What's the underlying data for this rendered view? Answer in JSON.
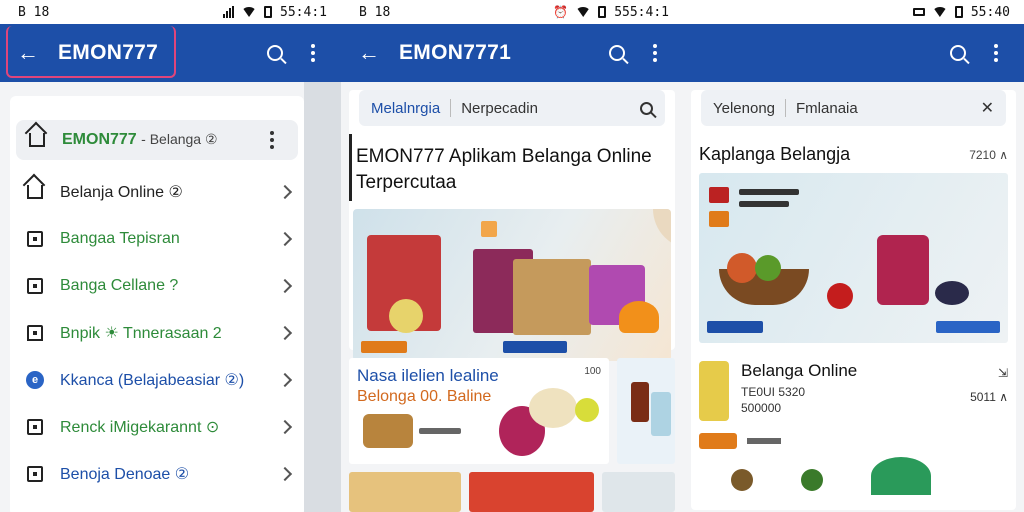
{
  "status_left": [
    "B 18",
    "B 18"
  ],
  "status_time": [
    "55:4:1",
    "555:4:1",
    "55:40"
  ],
  "app_title": [
    "EMON777",
    "EMON7771"
  ],
  "screen1": {
    "selected_item": {
      "title": "EMON777",
      "sub": "- Belanga ②"
    },
    "items": [
      {
        "label": "Belanja Online ②",
        "color": "#222222",
        "icon": "home-icon"
      },
      {
        "label": "Bangaa Tepisran",
        "color": "#2e8b3a",
        "icon": "box-icon"
      },
      {
        "label": "Banga Cellane ?",
        "color": "#2e8b3a",
        "icon": "square-icon"
      },
      {
        "label": "Bnpik ☀ Tnnerasaan 2",
        "color": "#2e8b3a",
        "icon": "bookmark-icon"
      },
      {
        "label": "Kkanca (Belajabeasiar ②)",
        "color": "#1d4fa8",
        "icon": "blue-circle-icon"
      },
      {
        "label": "Renck iMigekarannt ⊙",
        "color": "#2e8b3a",
        "icon": "doc-icon"
      },
      {
        "label": "Benoja Denoae ②",
        "color": "#1d4fa8",
        "icon": "square-icon"
      }
    ]
  },
  "screen2": {
    "search_left": "Melalnrgia",
    "search_right": "Nerpecadin",
    "headline": "EMON777 Aplikam Belanga Online Terpercutaa",
    "promo": {
      "line1": "Nasa ilelien lealine",
      "line2": "Belonga 00. Baline",
      "count": "100"
    }
  },
  "screen3": {
    "search_left": "Yelenong",
    "search_right": "Fmlanaia",
    "section_title": "Kaplanga Belangja",
    "section_count": "7210 ∧",
    "product_title": "Belanga Online",
    "product_line1": "TE0UI 5320",
    "product_line2": "500000",
    "product_side": "5011 ∧"
  },
  "colors": {
    "appbar": "#1d4fa8",
    "accent_green": "#2e8b3a",
    "accent_orange": "#e07b1a"
  }
}
